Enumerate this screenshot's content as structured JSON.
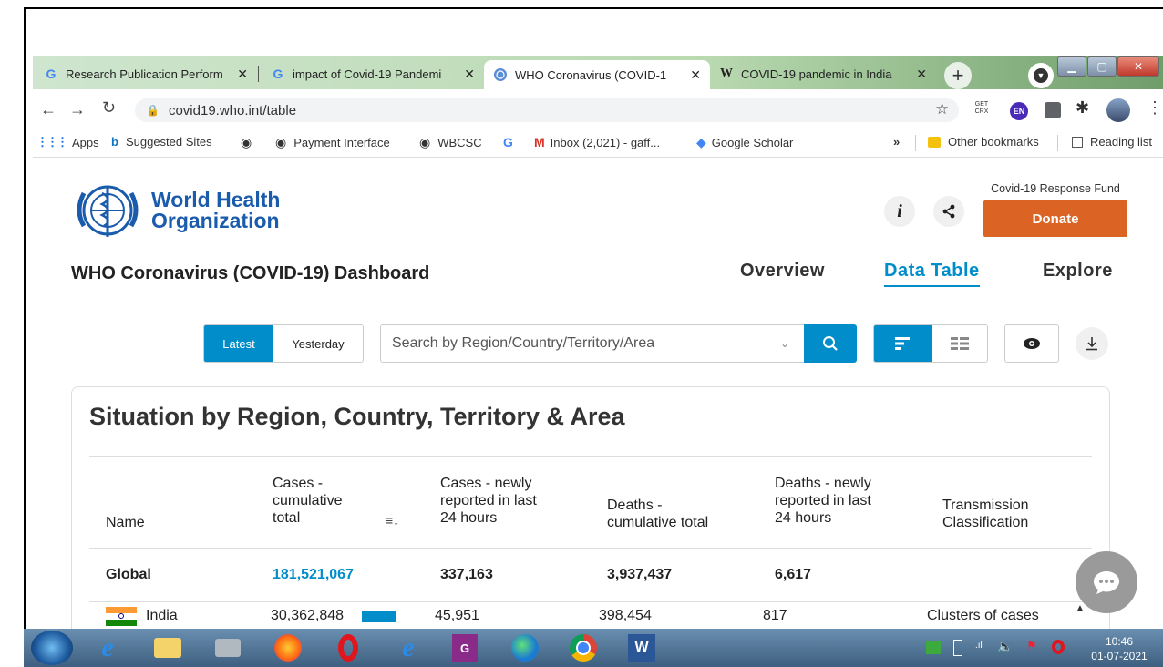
{
  "browser": {
    "tabs": [
      {
        "label": "Research Publication Perform",
        "favicon": "G"
      },
      {
        "label": "impact of Covid-19 Pandemi",
        "favicon": "G"
      },
      {
        "label": "WHO Coronavirus (COVID-1",
        "favicon": "globe-icon"
      },
      {
        "label": "COVID-19 pandemic in India",
        "favicon": "W"
      }
    ],
    "url": "covid19.who.int/table",
    "bookmarks": [
      {
        "label": "Apps",
        "icon": "apps-grid-icon"
      },
      {
        "label": "Suggested Sites",
        "icon": "bing-icon"
      },
      {
        "label": "",
        "icon": "globe-icon"
      },
      {
        "label": "Payment Interface",
        "icon": "globe-icon"
      },
      {
        "label": "WBCSC",
        "icon": "globe-icon"
      },
      {
        "label": "",
        "icon": "google-icon"
      },
      {
        "label": "Inbox (2,021) - gaff...",
        "icon": "gmail-icon"
      },
      {
        "label": "Google Scholar",
        "icon": "scholar-icon"
      }
    ],
    "bookmarks_right": [
      "Other bookmarks",
      "Reading list"
    ],
    "ext_getcrx": "GET CRX",
    "ext_en": "EN"
  },
  "header": {
    "logo_line1": "World Health",
    "logo_line2": "Organization",
    "fund_label": "Covid-19 Response Fund",
    "donate": "Donate",
    "dashboard_title": "WHO Coronavirus (COVID-19) Dashboard",
    "nav": [
      "Overview",
      "Data Table",
      "Explore"
    ]
  },
  "controls": {
    "latest": "Latest",
    "yesterday": "Yesterday",
    "search_placeholder": "Search by Region/Country/Territory/Area"
  },
  "table": {
    "title": "Situation by Region, Country, Territory & Area",
    "headers": {
      "name": "Name",
      "cases": [
        "Cases -",
        "cumulative",
        "total"
      ],
      "new_cases": [
        "Cases - newly",
        "reported in last",
        "24 hours"
      ],
      "deaths": [
        "Deaths -",
        "cumulative total"
      ],
      "new_deaths": [
        "Deaths - newly",
        "reported in last",
        "24 hours"
      ],
      "transmission": [
        "Transmission",
        "Classification"
      ]
    },
    "global": {
      "name": "Global",
      "cases": "181,521,067",
      "new_cases": "337,163",
      "deaths": "3,937,437",
      "new_deaths": "6,617"
    },
    "rows": [
      {
        "name": "India",
        "cases": "30,362,848",
        "new_cases": "45,951",
        "deaths": "398,454",
        "new_deaths": "817",
        "transmission": "Clusters of cases",
        "cases_bar_fraction": 0.17
      }
    ]
  },
  "taskbar": {
    "time": "10:46",
    "date": "01-07-2021"
  },
  "colors": {
    "who_blue": "#1a5bab",
    "accent": "#008dc9",
    "donate": "#db6424"
  }
}
